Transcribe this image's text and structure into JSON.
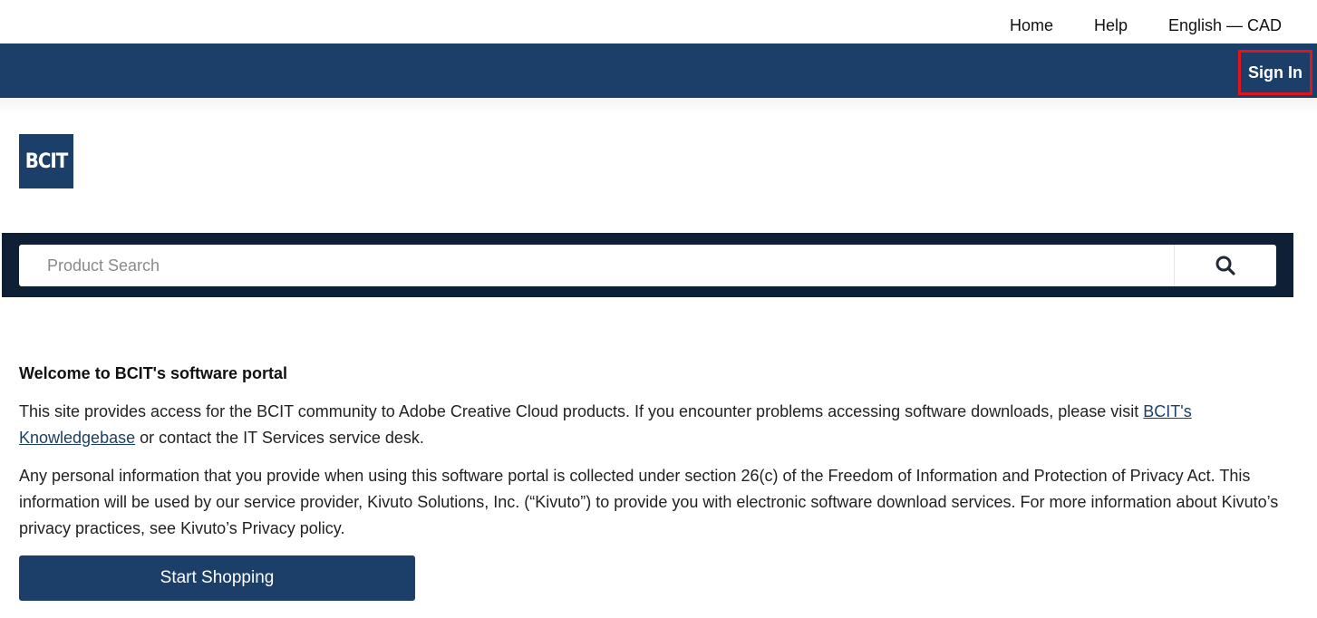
{
  "top_nav": {
    "home": "Home",
    "help": "Help",
    "language": "English — CAD"
  },
  "header": {
    "sign_in": "Sign In"
  },
  "logo": {
    "text": "BCIT"
  },
  "search": {
    "placeholder": "Product Search",
    "value": "",
    "icon": "search-icon"
  },
  "main": {
    "welcome_title": "Welcome to BCIT's software portal",
    "para1_before_link": "This site provides access for the BCIT community to Adobe Creative Cloud products. If you encounter problems accessing software downloads, please visit ",
    "para1_link": "BCIT's Knowledgebase",
    "para1_after_link": " or contact the IT Services service desk.",
    "para2": "Any personal information that you provide when using this software portal is collected under section 26(c) of the Freedom of Information and Protection of Privacy Act. This information will be used by our service provider, Kivuto Solutions, Inc. (“Kivuto”) to provide you with electronic software download services. For more information about Kivuto’s privacy practices, see Kivuto’s Privacy policy.",
    "start_shopping": "Start Shopping"
  },
  "colors": {
    "brand_blue": "#1b3f69",
    "search_band": "#0f1f35",
    "highlight_red": "#e0151c"
  }
}
